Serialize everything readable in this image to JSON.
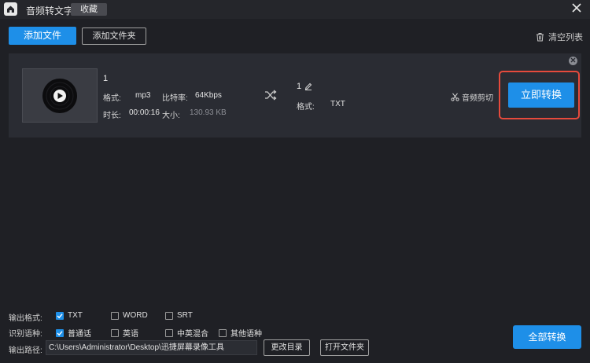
{
  "titlebar": {
    "home_icon": "home-icon",
    "app_title": "音频转文字",
    "fav_tab": "收藏",
    "close_icon": "close-icon"
  },
  "toolbar": {
    "add_file": "添加文件",
    "add_folder": "添加文件夹",
    "clear_list": "清空列表",
    "clear_icon": "trash-icon"
  },
  "file_item": {
    "source": {
      "name": "1",
      "format_label": "格式:",
      "format": "mp3",
      "bitrate_label": "比特率:",
      "bitrate": "64Kbps",
      "duration_label": "时长:",
      "duration": "00:00:16",
      "size_label": "大小:",
      "size": "130.93 KB"
    },
    "target": {
      "name": "1",
      "format_label": "格式:",
      "format": "TXT"
    },
    "audio_cut": "音频剪切",
    "convert_now": "立即转换"
  },
  "options": {
    "format_label": "输出格式:",
    "formats": [
      {
        "label": "TXT",
        "checked": true
      },
      {
        "label": "WORD",
        "checked": false
      },
      {
        "label": "SRT",
        "checked": false
      }
    ],
    "language_label": "识别语种:",
    "languages": [
      {
        "label": "普通话",
        "checked": true
      },
      {
        "label": "英语",
        "checked": false
      },
      {
        "label": "中英混合",
        "checked": false
      },
      {
        "label": "其他语种",
        "checked": false
      }
    ],
    "path_label": "输出路径:",
    "path_value": "C:\\Users\\Administrator\\Desktop\\迅捷屏幕录像工具",
    "change_dir": "更改目录",
    "open_folder": "打开文件夹"
  },
  "convert_all": "全部转换",
  "colors": {
    "accent": "#1e8fe8",
    "highlight_frame": "#e64a3c",
    "background": "#1f2025",
    "card": "#2a2c33"
  }
}
